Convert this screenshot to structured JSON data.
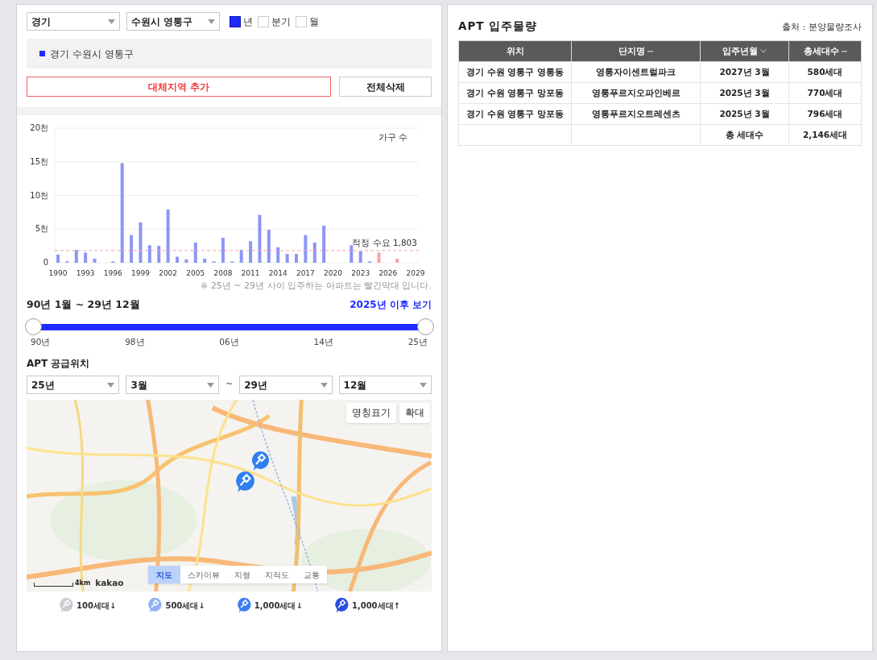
{
  "filters": {
    "province": "경기",
    "district": "수원시 영통구",
    "periods": [
      {
        "label": "년",
        "checked": true
      },
      {
        "label": "분기",
        "checked": false
      },
      {
        "label": "월",
        "checked": false
      }
    ]
  },
  "regions": [
    {
      "label": "경기 수원시 영통구",
      "color": "#1f2bff"
    }
  ],
  "buttons": {
    "add": "대체지역 추가",
    "clear": "전체삭제"
  },
  "chart": {
    "chart_data": {
      "type": "bar",
      "categories": [
        "1990",
        null,
        null,
        "1993",
        null,
        null,
        "1996",
        null,
        null,
        "1999",
        null,
        null,
        "2002",
        null,
        null,
        "2005",
        null,
        null,
        "2008",
        null,
        null,
        "2011",
        null,
        null,
        "2014",
        null,
        null,
        "2017",
        null,
        null,
        "2020",
        null,
        null,
        "2023",
        null,
        null,
        "2026",
        null,
        null,
        "2029"
      ],
      "ylabel": "가구 수",
      "grid": true,
      "ylim": [
        0,
        20
      ],
      "yticks": [
        {
          "value": 0,
          "label": "0"
        },
        {
          "value": 5,
          "label": "5천"
        },
        {
          "value": 10,
          "label": "10천"
        },
        {
          "value": 15,
          "label": "15천"
        },
        {
          "value": 20,
          "label": "20천"
        }
      ],
      "series": [
        {
          "color": "#8c96f5",
          "values": [
            1.2,
            0.2,
            1.9,
            1.5,
            0.6,
            null,
            0.2,
            14.8,
            4.1,
            6.0,
            2.6,
            2.5,
            7.9,
            0.9,
            0.5,
            3.0,
            0.6,
            0.2,
            3.7,
            0.2,
            1.9,
            3.2,
            7.1,
            4.9,
            2.3,
            1.3,
            1.3,
            4.1,
            3.0,
            5.5,
            null,
            null,
            2.6,
            1.7,
            0.2,
            null,
            null,
            null,
            null,
            null
          ]
        },
        {
          "color": "#f7a3ab",
          "values": [
            null,
            null,
            null,
            null,
            null,
            null,
            null,
            null,
            null,
            null,
            null,
            null,
            null,
            null,
            null,
            null,
            null,
            null,
            null,
            null,
            null,
            null,
            null,
            null,
            null,
            null,
            null,
            null,
            null,
            null,
            null,
            null,
            null,
            null,
            null,
            1.5,
            null,
            0.6,
            null,
            null
          ]
        }
      ],
      "ref_lines": [
        {
          "axis": "y",
          "value": 1.803,
          "label": "적정 수요 1,803",
          "color": "#f7a3ab"
        }
      ]
    },
    "note": "※ 25년 ~ 29년 사이 입주하는 아파트는 빨간막대 입니다."
  },
  "range": {
    "label": "90년 1월 ~ 29년 12월",
    "link": "2025년 이후 보기",
    "thumbs": [
      {
        "level": 0
      },
      {
        "level": 1
      }
    ],
    "ticks": [
      "90년",
      "98년",
      "06년",
      "14년",
      "25년"
    ]
  },
  "supply": {
    "title": "APT 공급위치",
    "from_year": "25년",
    "from_month": "3월",
    "separator": "~",
    "to_year": "29년",
    "to_month": "12월",
    "map": {
      "kind": "picture",
      "buttons": [
        "명칭표기",
        "확대"
      ],
      "map_types": [
        {
          "label": "지도",
          "selected": true
        },
        {
          "label": "스카이뷰",
          "selected": false
        },
        {
          "label": "지형",
          "selected": false
        },
        {
          "label": "지적도",
          "selected": false
        },
        {
          "label": "교통",
          "selected": false
        }
      ],
      "scale": "4km",
      "brand": "kakao"
    },
    "legend": [
      {
        "label": "100세대↓",
        "color": "#c9ccd3"
      },
      {
        "label": "500세대↓",
        "color": "#8fb0f2"
      },
      {
        "label": "1,000세대↓",
        "color": "#3b7cf0"
      },
      {
        "label": "1,000세대↑",
        "color": "#2a4fe0"
      }
    ]
  },
  "table": {
    "title": "APT 입주물량",
    "source": "출처 : 분양물량조사",
    "columns": [
      {
        "label": "위치",
        "sortable": false
      },
      {
        "label": "단지명",
        "sortable": true,
        "sorted": false
      },
      {
        "label": "입주년월",
        "sortable": true,
        "sorted": true
      },
      {
        "label": "총세대수",
        "sortable": true,
        "sorted": false
      }
    ],
    "rows": [
      [
        "경기 수원 영통구 영통동",
        "영통자이센트럴파크",
        "2027년 3월",
        "580세대"
      ],
      [
        "경기 수원 영통구 망포동",
        "영통푸르지오파인베르",
        "2025년 3월",
        "770세대"
      ],
      [
        "경기 수원 영통구 망포동",
        "영통푸르지오트레센츠",
        "2025년 3월",
        "796세대"
      ]
    ],
    "total": {
      "label": "총 세대수",
      "value": "2,146세대"
    }
  }
}
